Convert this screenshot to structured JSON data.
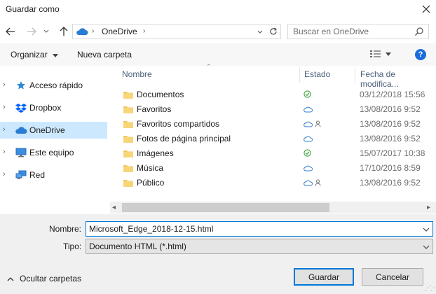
{
  "window": {
    "title": "Guardar como"
  },
  "address": {
    "path": "OneDrive"
  },
  "search": {
    "placeholder": "Buscar en OneDrive"
  },
  "toolbar": {
    "organize_label": "Organizar",
    "new_folder_label": "Nueva carpeta",
    "help_label": "?"
  },
  "sidebar": {
    "items": [
      {
        "label": "Acceso rápido",
        "icon": "star-icon"
      },
      {
        "label": "Dropbox",
        "icon": "dropbox-icon"
      },
      {
        "label": "OneDrive",
        "icon": "cloud-icon",
        "selected": true
      },
      {
        "label": "Este equipo",
        "icon": "computer-icon"
      },
      {
        "label": "Red",
        "icon": "network-icon"
      }
    ]
  },
  "columns": {
    "name": "Nombre",
    "status": "Estado",
    "date": "Fecha de modifica..."
  },
  "files": [
    {
      "name": "Documentos",
      "status": "synced",
      "date": "03/12/2018 15:56"
    },
    {
      "name": "Favoritos",
      "status": "cloud",
      "date": "13/08/2016 9:52"
    },
    {
      "name": "Favoritos compartidos",
      "status": "cloud-shared",
      "date": "13/08/2016 9:52"
    },
    {
      "name": "Fotos de página principal",
      "status": "cloud",
      "date": "13/08/2016 9:52"
    },
    {
      "name": "Imágenes",
      "status": "synced",
      "date": "15/07/2017 10:38"
    },
    {
      "name": "Música",
      "status": "cloud",
      "date": "17/10/2016 8:59"
    },
    {
      "name": "Público",
      "status": "cloud-shared",
      "date": "13/08/2016 9:52"
    }
  ],
  "form": {
    "name_label": "Nombre:",
    "name_value": "Microsoft_Edge_2018-12-15.html",
    "type_label": "Tipo:",
    "type_value": "Documento HTML (*.html)"
  },
  "footer": {
    "hide_folders_label": "Ocultar carpetas",
    "save_label": "Guardar",
    "cancel_label": "Cancelar"
  },
  "colors": {
    "accent": "#0078d7",
    "selected": "#cce8ff",
    "folder": "#f3c65a",
    "synced": "#3aa23a",
    "cloud": "#2b7cd3"
  }
}
